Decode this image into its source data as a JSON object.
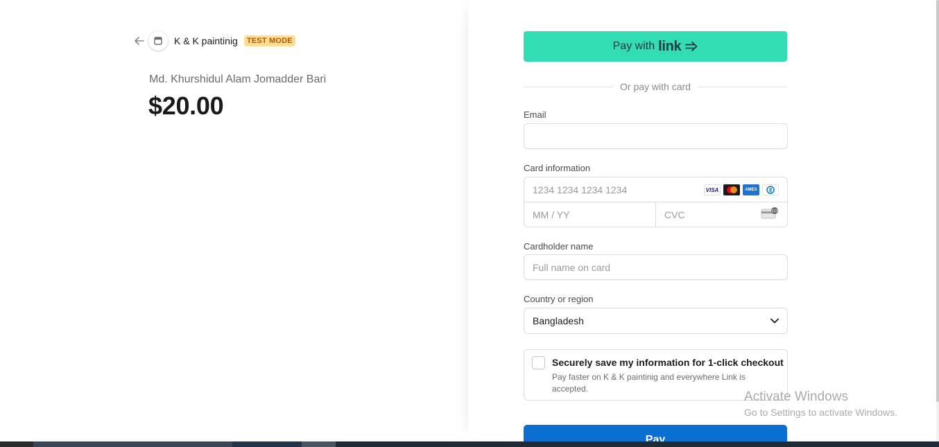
{
  "merchant": {
    "name": "K & K paintinig",
    "badge": "TEST MODE"
  },
  "product": {
    "name": "Md. Khurshidul Alam Jomadder Bari",
    "amount": "$20.00"
  },
  "link_button": {
    "prefix": "Pay with",
    "brand": "link"
  },
  "divider_text": "Or pay with card",
  "email": {
    "label": "Email",
    "value": "",
    "placeholder": ""
  },
  "card": {
    "label": "Card information",
    "number_placeholder": "1234 1234 1234 1234",
    "expiry_placeholder": "MM / YY",
    "cvc_placeholder": "CVC",
    "brands": [
      "VISA",
      "mastercard",
      "AMEX",
      "diners"
    ]
  },
  "cardholder": {
    "label": "Cardholder name",
    "placeholder": "Full name on card"
  },
  "country": {
    "label": "Country or region",
    "selected": "Bangladesh"
  },
  "save_info": {
    "checked": false,
    "title": "Securely save my information for 1-click checkout",
    "description": "Pay faster on K & K paintinig and everywhere Link is accepted."
  },
  "pay_button": {
    "label": "Pay"
  },
  "watermark": {
    "title": "Activate Windows",
    "subtitle": "Go to Settings to activate Windows."
  },
  "colors": {
    "link_green": "#33ddb3",
    "pay_blue": "#0a6fd0",
    "badge_bg": "#ffde92",
    "badge_text": "#bb5504"
  }
}
